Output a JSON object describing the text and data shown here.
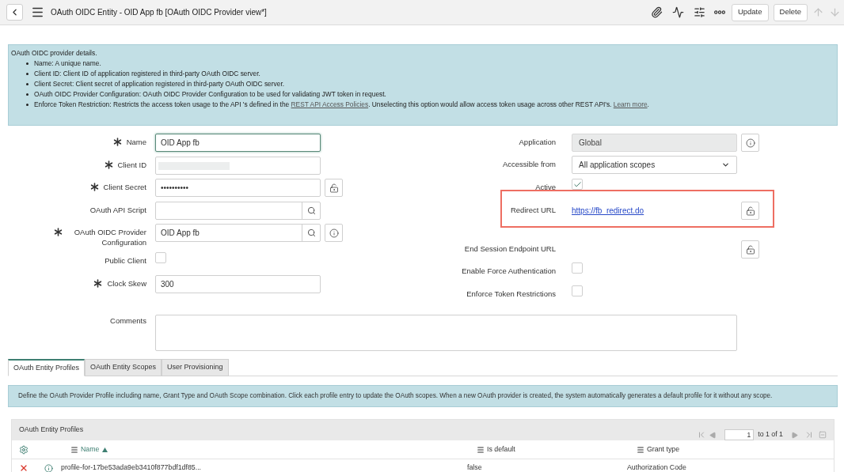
{
  "header": {
    "title": "OAuth OIDC Entity - OID App fb [OAuth OIDC Provider view*]",
    "buttons": [
      "Update",
      "Delete"
    ]
  },
  "info": {
    "intro": "OAuth OIDC provider details.",
    "items": [
      {
        "term": "Name:",
        "segments": [
          {
            "kind": "text",
            "text": " A unique name."
          }
        ]
      },
      {
        "term": "Client ID:",
        "segments": [
          {
            "kind": "text",
            "text": " Client ID of application registered in third-party OAuth OIDC server."
          }
        ]
      },
      {
        "term": "Client Secret:",
        "segments": [
          {
            "kind": "text",
            "text": " Client secret of application registered in third-party OAuth OIDC server."
          }
        ]
      },
      {
        "term": "OAuth OIDC Provider Configuration:",
        "segments": [
          {
            "kind": "text",
            "text": " OAuth OIDC Provider Configuration to be used for validating JWT token in request."
          }
        ]
      },
      {
        "term": "Enforce Token Restriction:",
        "segments": [
          {
            "kind": "text",
            "text": " Restricts the access token usage to the API 's defined in the "
          },
          {
            "kind": "link",
            "text": "REST API Access Policies"
          },
          {
            "kind": "text",
            "text": ". Unselecting this option would allow access token usage across other REST API's. "
          },
          {
            "kind": "link",
            "text": "Learn more"
          },
          {
            "kind": "text",
            "text": "."
          }
        ]
      }
    ]
  },
  "left_fields": [
    {
      "label": "Name",
      "required": true,
      "kind": "text",
      "value": "OID App fb",
      "focused": true
    },
    {
      "label": "Client ID",
      "required": true,
      "kind": "redacted"
    },
    {
      "label": "Client Secret",
      "required": true,
      "kind": "text",
      "value": "••••••••••",
      "focused": false,
      "lock": true
    },
    {
      "label": "OAuth API Script",
      "required": false,
      "kind": "reference"
    },
    {
      "label": "OAuth OIDC Provider Configuration",
      "required": true,
      "kind": "reference",
      "value": "OID App fb",
      "info": true
    },
    {
      "label": "Public Client",
      "required": false,
      "kind": "checkbox",
      "checked": false
    },
    {
      "label": "Clock Skew",
      "required": true,
      "kind": "text",
      "value": "300",
      "focused": false
    }
  ],
  "right_fields": [
    {
      "label": "Application",
      "kind": "readonly",
      "value": "Global",
      "highlighted": false,
      "info": true
    },
    {
      "label": "Accessible from",
      "kind": "select",
      "value": "All application scopes",
      "highlighted": false
    },
    {
      "label": "Active",
      "kind": "checkbox",
      "checked": true,
      "highlighted": false
    },
    {
      "label": "Redirect URL",
      "kind": "url",
      "value": "https://fb_redirect.do",
      "highlighted": true,
      "lock": true
    },
    {
      "label": "End Session Endpoint URL",
      "kind": "url",
      "highlighted": false,
      "lock": true
    },
    {
      "label": "Enable Force Authentication",
      "kind": "checkbox",
      "checked": false,
      "highlighted": false
    },
    {
      "label": "Enforce Token Restrictions",
      "kind": "checkbox",
      "checked": false,
      "highlighted": false
    }
  ],
  "comments": {
    "label": "Comments"
  },
  "tabs": [
    {
      "label": "OAuth Entity Profiles",
      "selected": true
    },
    {
      "label": "OAuth Entity Scopes",
      "selected": false
    },
    {
      "label": "User Provisioning",
      "selected": false
    }
  ],
  "tab_info": "Define the OAuth Provider Profile including name, Grant Type and OAuth Scope combination. Click each profile entry to update the OAuth scopes. When a new OAuth provider is created, the system automatically generates a default profile for it without any scope.",
  "related_list": {
    "title": "OAuth Entity Profiles",
    "page": "1",
    "page_total": "to 1 of 1",
    "columns": [
      {
        "label": "Name",
        "sorted": true
      },
      {
        "label": "Is default",
        "sorted": false
      },
      {
        "label": "Grant type",
        "sorted": false
      }
    ],
    "rows": [
      [
        "profile-for-17be53ada9eb3410f877bdf1df85...",
        "false",
        "Authorization Code"
      ]
    ]
  }
}
